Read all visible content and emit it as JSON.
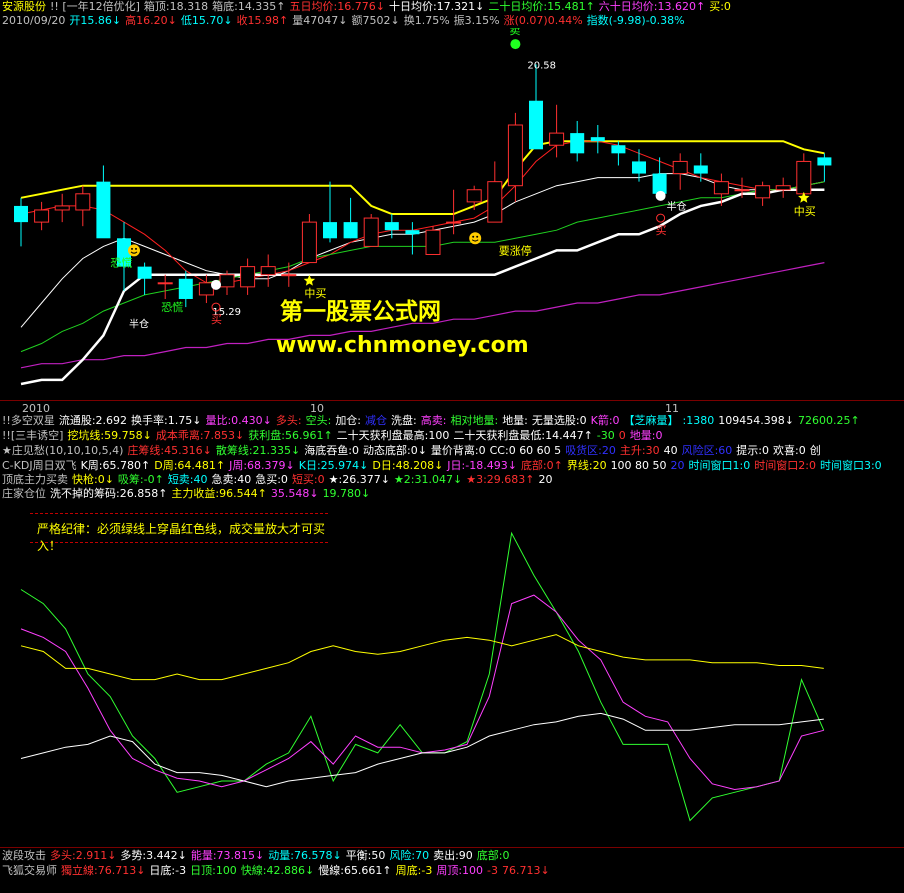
{
  "header": {
    "line1": [
      {
        "t": "安源股份",
        "c": "#ffff00"
      },
      {
        "t": "!! [一年12倍优化]",
        "c": "#c0c0c0"
      },
      {
        "t": "箱顶:18.318",
        "c": "#c0c0c0"
      },
      {
        "t": "箱底:14.335↑",
        "c": "#c0c0c0"
      },
      {
        "t": "五日均价:16.776↓",
        "c": "#ff3030"
      },
      {
        "t": "十日均价:17.321↓",
        "c": "#ffffff"
      },
      {
        "t": "二十日均价:15.481↑",
        "c": "#30ff30"
      },
      {
        "t": "六十日均价:13.620↑",
        "c": "#ff40ff"
      },
      {
        "t": "买:0",
        "c": "#ffff00"
      }
    ],
    "line2": [
      {
        "t": "2010/09/20",
        "c": "#c0c0c0"
      },
      {
        "t": "开15.86↓",
        "c": "#00ffff"
      },
      {
        "t": "高16.20↓",
        "c": "#ff3030"
      },
      {
        "t": "低15.70↓",
        "c": "#00ffff"
      },
      {
        "t": "收15.98↑",
        "c": "#ff3030"
      },
      {
        "t": "量47047↓",
        "c": "#c0c0c0"
      },
      {
        "t": "额7502↓",
        "c": "#c0c0c0"
      },
      {
        "t": "换1.75%",
        "c": "#c0c0c0"
      },
      {
        "t": "振3.15%",
        "c": "#c0c0c0"
      },
      {
        "t": "涨(0.07)0.44%",
        "c": "#ff3030"
      },
      {
        "t": "指数(-9.98)-0.38%",
        "c": "#00ffff"
      }
    ]
  },
  "annotations": {
    "sell": "卖",
    "price_high": "20.58",
    "price_low": "15.29",
    "panic1": "恐慌",
    "panic2": "恐慌",
    "half_pos": "半仓",
    "half_pos2": "半仓",
    "limit_up": "要涨停",
    "buy1": "买",
    "mid_buy1": "中买",
    "mid_buy2": "中买",
    "buy2": "买"
  },
  "watermark": {
    "cn": "第一股票公式网",
    "url": "www.chnmoney.com"
  },
  "axis": {
    "labels": [
      "2010",
      "10",
      "11"
    ]
  },
  "indicators": [
    [
      {
        "t": "!!多空双星",
        "c": "#c0c0c0"
      },
      {
        "t": "流通股:2.692",
        "c": "#ffffff"
      },
      {
        "t": "换手率:1.75↓",
        "c": "#ffffff"
      },
      {
        "t": "量比:0.430↓",
        "c": "#ff40ff"
      },
      {
        "t": "多头:",
        "c": "#ff3030"
      },
      {
        "t": "空头:",
        "c": "#30ff30"
      },
      {
        "t": "加仓:",
        "c": "#ffffff"
      },
      {
        "t": "减仓",
        "c": "#3030ff"
      },
      {
        "t": "洗盘:",
        "c": "#ffffff"
      },
      {
        "t": "高卖:",
        "c": "#ff40ff"
      },
      {
        "t": "相对地量:",
        "c": "#30ff30"
      },
      {
        "t": "地量:",
        "c": "#ffffff"
      },
      {
        "t": "无量选股:0",
        "c": "#ffffff"
      },
      {
        "t": "K箭:0",
        "c": "#ff40ff"
      },
      {
        "t": "【芝麻量】",
        "c": "#00ffff"
      },
      {
        "t": ":1380",
        "c": "#00ffff"
      },
      {
        "t": "109454.398↓",
        "c": "#ffffff"
      },
      {
        "t": "72600.25↑",
        "c": "#30ff30"
      }
    ],
    [
      {
        "t": "!![三丰诱空]",
        "c": "#c0c0c0"
      },
      {
        "t": "挖坑线:59.758↓",
        "c": "#ffff00"
      },
      {
        "t": "成本乖离:7.853↓",
        "c": "#ff3030"
      },
      {
        "t": "获利盘:56.961↑",
        "c": "#30ff30"
      },
      {
        "t": "二十天获利盘最高:100",
        "c": "#ffffff"
      },
      {
        "t": "二十天获利盘最低:14.447↑",
        "c": "#ffffff"
      },
      {
        "t": "-30",
        "c": "#30ff30"
      },
      {
        "t": "0",
        "c": "#ff3030"
      },
      {
        "t": "地量:0",
        "c": "#ff40ff"
      }
    ],
    [
      {
        "t": "★庄见愁(10,10,10,5,4)",
        "c": "#c0c0c0"
      },
      {
        "t": "庄筹线:45.316↓",
        "c": "#ff3030"
      },
      {
        "t": "散筹线:21.335↓",
        "c": "#30ff30"
      },
      {
        "t": "海底吞鱼:0",
        "c": "#ffffff"
      },
      {
        "t": "动态底部:0↓",
        "c": "#ffffff"
      },
      {
        "t": "量价背离:0",
        "c": "#ffffff"
      },
      {
        "t": "CC:0 60 60 5",
        "c": "#ffffff"
      },
      {
        "t": "吸货区:20",
        "c": "#3030ff"
      },
      {
        "t": "主升:30",
        "c": "#ff3030"
      },
      {
        "t": "40",
        "c": "#ffffff"
      },
      {
        "t": "风险区:60",
        "c": "#3030ff"
      },
      {
        "t": "提示:0",
        "c": "#ffffff"
      },
      {
        "t": "欢喜:0",
        "c": "#ffffff"
      },
      {
        "t": "创",
        "c": "#ffffff"
      }
    ],
    [
      {
        "t": "C-KDJ周日双飞",
        "c": "#c0c0c0"
      },
      {
        "t": "K周:65.780↑",
        "c": "#ffffff"
      },
      {
        "t": "D周:64.481↑",
        "c": "#ffff00"
      },
      {
        "t": "J周:68.379↓",
        "c": "#ff40ff"
      },
      {
        "t": "K日:25.974↓",
        "c": "#00ffff"
      },
      {
        "t": "D日:48.208↓",
        "c": "#ffff00"
      },
      {
        "t": "J日:-18.493↓",
        "c": "#ff40ff"
      },
      {
        "t": "底部:0↑",
        "c": "#ff3030"
      },
      {
        "t": "界线:20",
        "c": "#ffff00"
      },
      {
        "t": "100 80 50",
        "c": "#ffffff"
      },
      {
        "t": "20",
        "c": "#3030ff"
      },
      {
        "t": "时间窗口1:0",
        "c": "#00ffff"
      },
      {
        "t": "时间窗口2:0",
        "c": "#ff3030"
      },
      {
        "t": "时间窗口3:0",
        "c": "#00ffff"
      }
    ],
    [
      {
        "t": "顶底主力买卖",
        "c": "#c0c0c0"
      },
      {
        "t": "快枪:0↓",
        "c": "#ffff00"
      },
      {
        "t": "吸筹:-0↑",
        "c": "#30ff30"
      },
      {
        "t": "短卖:40",
        "c": "#00ffff"
      },
      {
        "t": "急卖:40",
        "c": "#ffffff"
      },
      {
        "t": "急买:0",
        "c": "#ffffff"
      },
      {
        "t": "短买:0",
        "c": "#ff3030"
      }
    ],
    [
      {
        "t": "庄家仓位",
        "c": "#c0c0c0"
      },
      {
        "t": "洗不掉的筹码:26.858↑",
        "c": "#ffffff"
      },
      {
        "t": "主力收益:96.544↑",
        "c": "#ffff00"
      },
      {
        "t": "35.548↓",
        "c": "#ff40ff"
      },
      {
        "t": "19.780↓",
        "c": "#30ff30"
      }
    ]
  ],
  "ind_extra": [
    {
      "t": "★:26.377↓",
      "c": "#ffffff"
    },
    {
      "t": "★2:31.047↓",
      "c": "#30ff30"
    },
    {
      "t": "★3:29.683↑",
      "c": "#ff3030"
    },
    {
      "t": "20",
      "c": "#ffffff"
    }
  ],
  "rule_text": "严格纪律：必须绿线上穿晶红色线，成交量放大才可买入！",
  "bottom": [
    [
      {
        "t": "波段攻击",
        "c": "#c0c0c0"
      },
      {
        "t": "多头:2.911↓",
        "c": "#ff3030"
      },
      {
        "t": "多势:3.442↓",
        "c": "#ffffff"
      },
      {
        "t": "能量:73.815↓",
        "c": "#ff40ff"
      },
      {
        "t": "动量:76.578↓",
        "c": "#00ffff"
      },
      {
        "t": "平衡:50",
        "c": "#ffffff"
      },
      {
        "t": "风险:70",
        "c": "#00ffff"
      },
      {
        "t": "卖出:90",
        "c": "#ffffff"
      },
      {
        "t": "底部:0",
        "c": "#30ff30"
      }
    ],
    [
      {
        "t": "飞狐交易师",
        "c": "#c0c0c0"
      },
      {
        "t": "獨立線:76.713↓",
        "c": "#ff3030"
      },
      {
        "t": "日底:-3",
        "c": "#ffffff"
      },
      {
        "t": "日顶:100",
        "c": "#30ff30"
      },
      {
        "t": "快線:42.886↓",
        "c": "#30ff30"
      },
      {
        "t": "慢線:65.661↑",
        "c": "#ffffff"
      },
      {
        "t": "周底:-3",
        "c": "#ffff00"
      },
      {
        "t": "周顶:100",
        "c": "#ff40ff"
      },
      {
        "t": "-3",
        "c": "#ff3030"
      },
      {
        "t": "76.713↓",
        "c": "#ff3030"
      }
    ]
  ],
  "chart_data": [
    {
      "type": "candlestick",
      "title": "安源股份",
      "ylim": [
        12.5,
        21.2
      ],
      "candles": [
        {
          "o": 17.0,
          "h": 17.2,
          "l": 16.0,
          "c": 16.6
        },
        {
          "o": 16.6,
          "h": 17.1,
          "l": 16.4,
          "c": 16.9
        },
        {
          "o": 16.9,
          "h": 17.3,
          "l": 16.6,
          "c": 17.0
        },
        {
          "o": 16.9,
          "h": 17.5,
          "l": 16.5,
          "c": 17.3
        },
        {
          "o": 17.6,
          "h": 18.0,
          "l": 16.6,
          "c": 16.2
        },
        {
          "o": 16.2,
          "h": 16.6,
          "l": 14.9,
          "c": 15.5
        },
        {
          "o": 15.5,
          "h": 15.6,
          "l": 14.8,
          "c": 15.2
        },
        {
          "o": 15.1,
          "h": 15.3,
          "l": 14.7,
          "c": 15.1
        },
        {
          "o": 15.2,
          "h": 15.4,
          "l": 14.5,
          "c": 14.7
        },
        {
          "o": 14.8,
          "h": 15.3,
          "l": 14.6,
          "c": 15.1
        },
        {
          "o": 15.0,
          "h": 15.4,
          "l": 14.8,
          "c": 15.3
        },
        {
          "o": 15.0,
          "h": 15.7,
          "l": 14.8,
          "c": 15.5
        },
        {
          "o": 15.3,
          "h": 15.8,
          "l": 15.0,
          "c": 15.5
        },
        {
          "o": 15.3,
          "h": 15.6,
          "l": 15.0,
          "c": 15.3
        },
        {
          "o": 15.6,
          "h": 16.8,
          "l": 15.6,
          "c": 16.6
        },
        {
          "o": 16.6,
          "h": 17.6,
          "l": 16.1,
          "c": 16.2
        },
        {
          "o": 16.6,
          "h": 17.2,
          "l": 16.2,
          "c": 16.2
        },
        {
          "o": 16.0,
          "h": 16.8,
          "l": 16.0,
          "c": 16.7
        },
        {
          "o": 16.6,
          "h": 16.8,
          "l": 16.2,
          "c": 16.4
        },
        {
          "o": 16.4,
          "h": 16.6,
          "l": 15.8,
          "c": 16.3
        },
        {
          "o": 15.8,
          "h": 16.5,
          "l": 15.8,
          "c": 16.4
        },
        {
          "o": 16.6,
          "h": 17.4,
          "l": 16.3,
          "c": 16.6
        },
        {
          "o": 17.1,
          "h": 17.5,
          "l": 16.9,
          "c": 17.4
        },
        {
          "o": 16.6,
          "h": 18.1,
          "l": 16.6,
          "c": 17.6
        },
        {
          "o": 17.5,
          "h": 19.3,
          "l": 17.1,
          "c": 19.0
        },
        {
          "o": 19.6,
          "h": 20.5,
          "l": 19.2,
          "c": 18.4
        },
        {
          "o": 18.5,
          "h": 19.5,
          "l": 18.2,
          "c": 18.8
        },
        {
          "o": 18.8,
          "h": 19.1,
          "l": 18.1,
          "c": 18.3
        },
        {
          "o": 18.7,
          "h": 19.0,
          "l": 18.3,
          "c": 18.6
        },
        {
          "o": 18.5,
          "h": 18.6,
          "l": 18.0,
          "c": 18.3
        },
        {
          "o": 18.1,
          "h": 18.4,
          "l": 17.6,
          "c": 17.8
        },
        {
          "o": 17.8,
          "h": 18.2,
          "l": 17.2,
          "c": 17.3
        },
        {
          "o": 17.8,
          "h": 18.3,
          "l": 17.4,
          "c": 18.1
        },
        {
          "o": 18.0,
          "h": 18.3,
          "l": 17.6,
          "c": 17.8
        },
        {
          "o": 17.3,
          "h": 17.8,
          "l": 17.0,
          "c": 17.6
        },
        {
          "o": 17.4,
          "h": 17.7,
          "l": 17.2,
          "c": 17.4
        },
        {
          "o": 17.2,
          "h": 17.6,
          "l": 17.0,
          "c": 17.5
        },
        {
          "o": 17.4,
          "h": 17.7,
          "l": 17.2,
          "c": 17.5
        },
        {
          "o": 17.3,
          "h": 18.3,
          "l": 17.3,
          "c": 18.1
        },
        {
          "o": 18.2,
          "h": 18.3,
          "l": 17.6,
          "c": 18.0
        }
      ],
      "lines": {
        "box": [
          17.2,
          17.3,
          17.4,
          17.5,
          17.5,
          17.5,
          17.5,
          17.5,
          17.5,
          17.5,
          17.5,
          17.5,
          17.5,
          17.5,
          17.5,
          17.5,
          17.5,
          17.0,
          16.8,
          16.8,
          16.8,
          16.8,
          17.0,
          17.2,
          17.9,
          18.5,
          18.6,
          18.6,
          18.6,
          18.6,
          18.6,
          18.6,
          18.6,
          18.6,
          18.6,
          18.6,
          18.6,
          18.6,
          18.4,
          18.3
        ],
        "white": [
          14.0,
          14.6,
          15.2,
          15.7,
          16.0,
          16.2,
          16.0,
          15.8,
          15.6,
          15.4,
          15.3,
          15.2,
          15.2,
          15.4,
          15.7,
          15.9,
          16.1,
          16.2,
          16.3,
          16.3,
          16.4,
          16.5,
          16.6,
          16.8,
          17.1,
          17.3,
          17.5,
          17.6,
          17.7,
          17.7,
          17.7,
          17.8,
          17.8,
          17.7,
          17.5,
          17.4,
          17.4,
          17.4,
          17.5,
          17.6
        ],
        "red": [
          16.8,
          16.9,
          17.0,
          17.0,
          16.9,
          16.6,
          16.3,
          15.9,
          15.4,
          15.1,
          15.1,
          15.2,
          15.3,
          15.4,
          15.6,
          15.8,
          16.1,
          16.3,
          16.4,
          16.4,
          16.5,
          16.6,
          16.7,
          17.0,
          17.5,
          18.1,
          18.5,
          18.6,
          18.6,
          18.5,
          18.3,
          18.1,
          17.9,
          17.7,
          17.6,
          17.5,
          17.4,
          17.4,
          17.5,
          17.6
        ],
        "green": [
          13.4,
          13.6,
          13.9,
          14.1,
          14.4,
          14.6,
          14.8,
          14.9,
          15.0,
          15.1,
          15.2,
          15.3,
          15.4,
          15.5,
          15.7,
          15.8,
          15.9,
          16.0,
          16.0,
          16.0,
          16.0,
          16.1,
          16.1,
          16.1,
          16.2,
          16.3,
          16.4,
          16.6,
          16.7,
          16.8,
          16.9,
          17.0,
          17.1,
          17.2,
          17.2,
          17.3,
          17.4,
          17.4,
          17.5,
          17.6
        ],
        "magenta": [
          13.0,
          13.1,
          13.1,
          13.2,
          13.2,
          13.3,
          13.3,
          13.4,
          13.5,
          13.5,
          13.6,
          13.6,
          13.7,
          13.7,
          13.8,
          13.8,
          13.9,
          13.9,
          14.0,
          14.1,
          14.1,
          14.2,
          14.2,
          14.3,
          14.4,
          14.4,
          14.5,
          14.6,
          14.6,
          14.7,
          14.8,
          14.8,
          14.9,
          15.0,
          15.1,
          15.2,
          15.3,
          15.4,
          15.5,
          15.6
        ],
        "stop": [
          12.6,
          12.7,
          12.7,
          13.2,
          13.8,
          14.9,
          15.3,
          15.3,
          15.3,
          15.3,
          15.3,
          15.3,
          15.3,
          15.3,
          15.3,
          15.3,
          15.3,
          15.3,
          15.3,
          15.3,
          15.3,
          15.3,
          15.3,
          15.3,
          15.5,
          15.7,
          15.9,
          15.9,
          16.1,
          16.3,
          16.3,
          16.5,
          16.8,
          17.0,
          17.1,
          17.3,
          17.3,
          17.4,
          17.4,
          17.4
        ]
      }
    },
    {
      "type": "line",
      "ylim": [
        -10,
        110
      ],
      "series": [
        {
          "color": "#30ff30",
          "values": [
            80,
            75,
            66,
            50,
            42,
            28,
            20,
            8,
            10,
            12,
            12,
            18,
            22,
            35,
            12,
            25,
            22,
            32,
            22,
            22,
            26,
            50,
            100,
            85,
            72,
            58,
            40,
            25,
            25,
            25,
            -2,
            6,
            8,
            10,
            12,
            48,
            30
          ]
        },
        {
          "color": "#ff40ff",
          "values": [
            66,
            63,
            58,
            45,
            30,
            20,
            16,
            13,
            12,
            10,
            12,
            16,
            20,
            26,
            18,
            28,
            24,
            24,
            22,
            23,
            25,
            42,
            75,
            78,
            72,
            62,
            55,
            40,
            35,
            33,
            20,
            11,
            9,
            10,
            12,
            28,
            30
          ]
        },
        {
          "color": "#ffff00",
          "values": [
            60,
            58,
            52,
            52,
            50,
            48,
            48,
            50,
            48,
            48,
            50,
            52,
            54,
            58,
            60,
            58,
            57,
            58,
            60,
            62,
            63,
            62,
            60,
            62,
            64,
            60,
            58,
            56,
            55,
            55,
            55,
            54,
            54,
            54,
            53,
            53,
            52
          ]
        },
        {
          "color": "#ffffff",
          "values": [
            20,
            22,
            24,
            25,
            28,
            26,
            18,
            15,
            15,
            14,
            12,
            10,
            12,
            13,
            14,
            15,
            18,
            20,
            22,
            22,
            24,
            28,
            30,
            32,
            33,
            35,
            36,
            34,
            30,
            30,
            30,
            31,
            32,
            32,
            32,
            33,
            34
          ]
        }
      ]
    }
  ]
}
